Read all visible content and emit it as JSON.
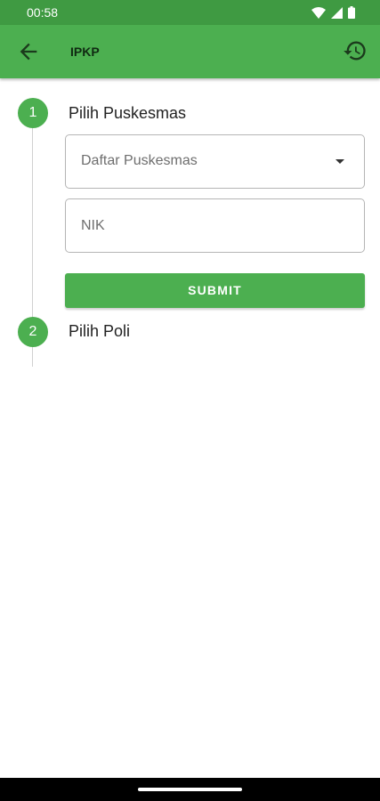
{
  "status_bar": {
    "time": "00:58",
    "icons": [
      "wifi-icon",
      "signal-icon",
      "battery-icon"
    ]
  },
  "app_bar": {
    "title": "IPKP",
    "back_icon": "arrow-left-icon",
    "history_icon": "history-icon",
    "color": "#4caf50"
  },
  "steps": [
    {
      "number": "1",
      "title": "Pilih Puskesmas",
      "dropdown": {
        "selected": "Daftar Puskesmas"
      },
      "nik": {
        "placeholder": "NIK",
        "value": ""
      },
      "submit_label": "SUBMIT"
    },
    {
      "number": "2",
      "title": "Pilih Poli"
    }
  ]
}
